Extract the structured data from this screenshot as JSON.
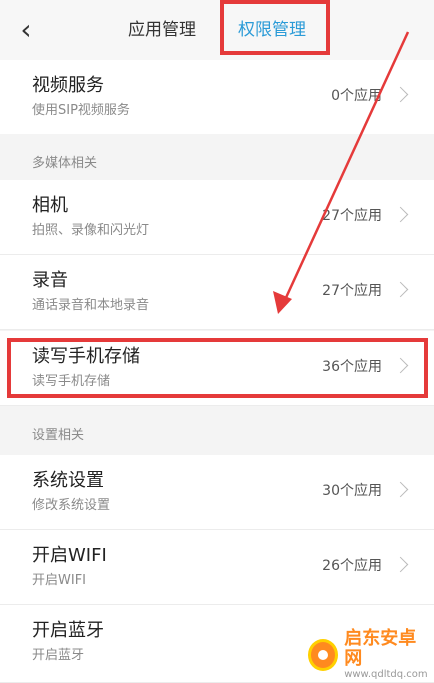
{
  "header": {
    "back_icon": "chevron-left-icon",
    "tabs": [
      {
        "label": "应用管理"
      },
      {
        "label": "权限管理"
      }
    ],
    "active_color": "#2b9bd7"
  },
  "rows": {
    "video": {
      "title": "视频服务",
      "subtitle": "使用SIP视频服务",
      "count": "0个应用"
    },
    "camera": {
      "title": "相机",
      "subtitle": "拍照、录像和闪光灯",
      "count": "27个应用"
    },
    "record": {
      "title": "录音",
      "subtitle": "通话录音和本地录音",
      "count": "27个应用"
    },
    "storage": {
      "title": "读写手机存储",
      "subtitle": "读写手机存储",
      "count": "36个应用"
    },
    "settings": {
      "title": "系统设置",
      "subtitle": "修改系统设置",
      "count": "30个应用"
    },
    "wifi": {
      "title": "开启WIFI",
      "subtitle": "开启WIFI",
      "count": "26个应用"
    },
    "bt": {
      "title": "开启蓝牙",
      "subtitle": "开启蓝牙"
    }
  },
  "sections": {
    "multimedia": "多媒体相关",
    "settings": "设置相关"
  },
  "annotation_color": "#e53a3a",
  "watermark": {
    "title": "启东安卓网",
    "url": "www.qdltdq.com"
  }
}
